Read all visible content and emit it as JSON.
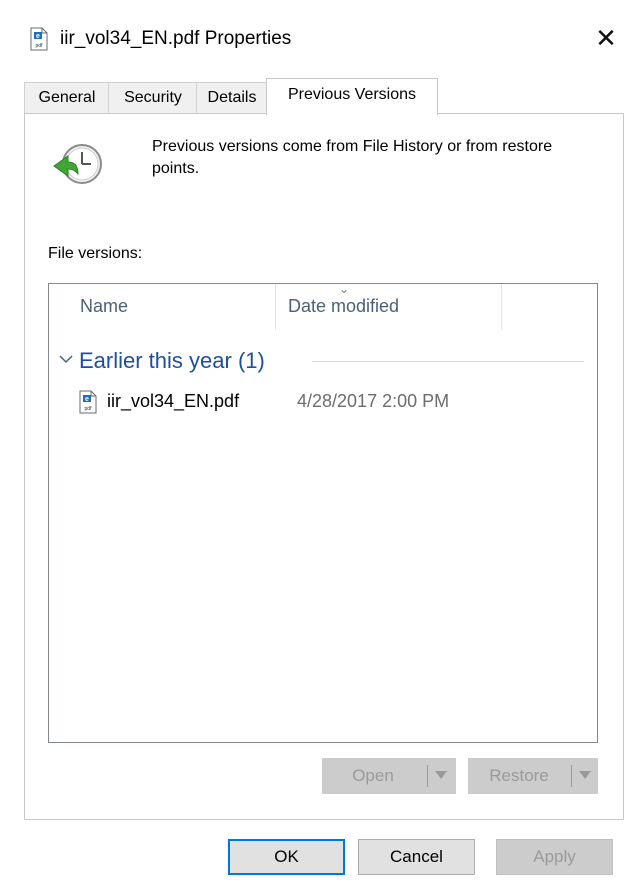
{
  "window": {
    "title": "iir_vol34_EN.pdf Properties",
    "close_glyph": "✕",
    "title_icon": "pdf-file-icon"
  },
  "tabs": [
    {
      "label": "General",
      "active": false
    },
    {
      "label": "Security",
      "active": false
    },
    {
      "label": "Details",
      "active": false
    },
    {
      "label": "Previous Versions",
      "active": true
    }
  ],
  "info": {
    "icon": "file-history-clock-icon",
    "text": "Previous versions come from File History or from restore points."
  },
  "file_versions": {
    "label": "File versions:",
    "columns": [
      "Name",
      "Date modified"
    ],
    "groups": [
      {
        "label": "Earlier this year (1)",
        "expanded": true,
        "items": [
          {
            "name": "iir_vol34_EN.pdf",
            "date_modified": "4/28/2017 2:00 PM",
            "icon": "pdf-file-icon"
          }
        ]
      }
    ]
  },
  "actions": {
    "open": {
      "label": "Open",
      "enabled": false
    },
    "restore": {
      "label": "Restore",
      "enabled": false
    }
  },
  "footer": {
    "ok": "OK",
    "cancel": "Cancel",
    "apply": "Apply",
    "apply_enabled": false
  },
  "colors": {
    "group_header": "#1e4f9c",
    "column_header": "#4c607a",
    "default_button_border": "#0078d7",
    "icon_green": "#3fa535"
  }
}
